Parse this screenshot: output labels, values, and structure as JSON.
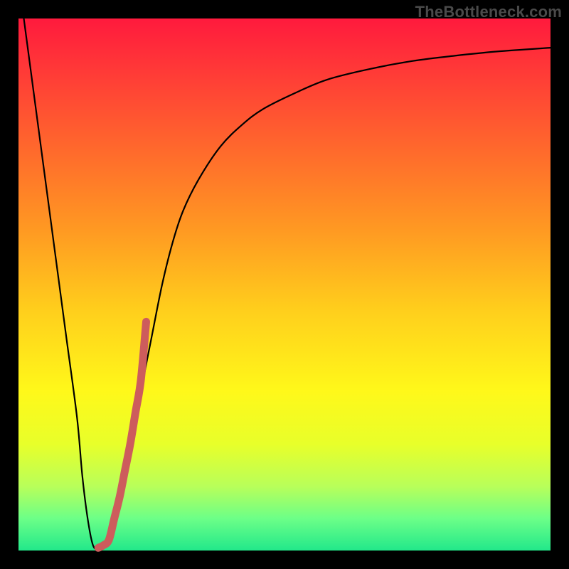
{
  "watermark": "TheBottleneck.com",
  "colors": {
    "frame": "#000000",
    "curve": "#000000",
    "highlight": "#cd5c5c",
    "gradient_top": "#ff1a3d",
    "gradient_bottom": "#22e88a"
  },
  "chart_data": {
    "type": "line",
    "title": "",
    "xlabel": "",
    "ylabel": "",
    "xlim": [
      0,
      100
    ],
    "ylim": [
      0,
      100
    ],
    "series": [
      {
        "name": "bottleneck-curve",
        "x": [
          1,
          3,
          5,
          7,
          9,
          11,
          12,
          13,
          14,
          15,
          17,
          19,
          21,
          23,
          25,
          27,
          29,
          31,
          34,
          38,
          42,
          46,
          52,
          58,
          66,
          74,
          82,
          90,
          100
        ],
        "y": [
          100,
          85,
          70,
          55,
          40,
          25,
          14,
          6,
          1,
          0.5,
          2,
          10,
          20,
          30,
          40,
          50,
          58,
          64,
          70,
          76,
          80,
          83,
          86,
          88.5,
          90.5,
          92,
          93,
          93.8,
          94.5
        ]
      },
      {
        "name": "highlight-segment",
        "x": [
          15,
          16,
          17,
          18,
          19,
          20,
          21,
          22,
          23,
          24
        ],
        "y": [
          0.5,
          1,
          2,
          6,
          10,
          15,
          20,
          26,
          32,
          43
        ]
      }
    ]
  }
}
